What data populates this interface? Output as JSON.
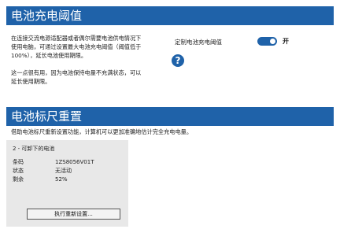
{
  "threshold": {
    "title": "电池充电阈值",
    "desc1_line1": "在连接交流电源适配器或者偶尔需要电池供电情况下",
    "desc1_line2": "使用电脑，可通过设置最大电池充电阈值（阈值低于",
    "desc1_line3": "100%），延长电池使用期限。",
    "desc2_line1": "这一点很有用，因为电池保持电量不充满状态，可以",
    "desc2_line2": "延长使用期限。",
    "setting_label": "定制电池充电阈值",
    "toggle_state": "开",
    "toggle_on": true,
    "help_glyph": "?"
  },
  "recalibrate": {
    "title": "电池标尺重置",
    "desc": "借助电池标尺重新设置功能，计算机可以更加准确地估计完全充电电量。",
    "battery": {
      "title": "2 - 可卸下的电池",
      "fields": [
        {
          "label": "条码",
          "value": "1ZS8056V01T"
        },
        {
          "label": "状态",
          "value": "无活动"
        },
        {
          "label": "剩余",
          "value": "52%"
        }
      ]
    },
    "button_label": "执行重新设置..."
  }
}
